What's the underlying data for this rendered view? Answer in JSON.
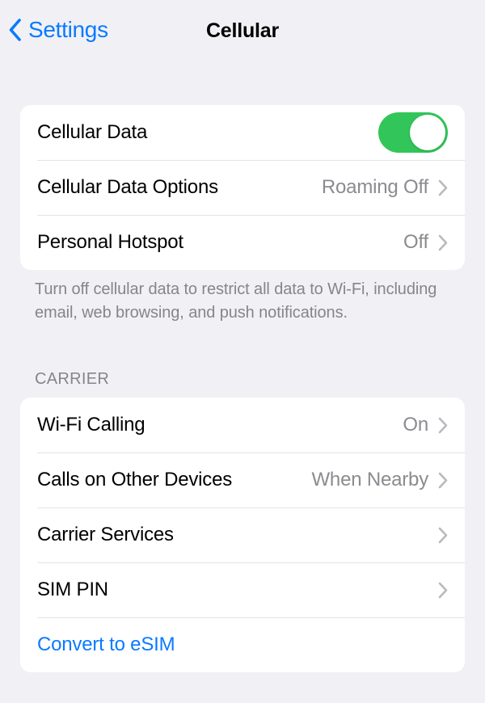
{
  "navbar": {
    "back_label": "Settings",
    "back_icon": "chevron-left-icon",
    "title": "Cellular"
  },
  "data_section": {
    "rows": [
      {
        "label": "Cellular Data",
        "control": "toggle",
        "toggle_on": true,
        "value": ""
      },
      {
        "label": "Cellular Data Options",
        "control": "disclosure",
        "value": "Roaming Off"
      },
      {
        "label": "Personal Hotspot",
        "control": "disclosure",
        "value": "Off"
      }
    ],
    "footer": "Turn off cellular data to restrict all data to Wi-Fi, including email, web browsing, and push notifications."
  },
  "carrier_section": {
    "header": "CARRIER",
    "rows": [
      {
        "label": "Wi-Fi Calling",
        "control": "disclosure",
        "value": "On"
      },
      {
        "label": "Calls on Other Devices",
        "control": "disclosure",
        "value": "When Nearby"
      },
      {
        "label": "Carrier Services",
        "control": "disclosure",
        "value": ""
      },
      {
        "label": "SIM PIN",
        "control": "disclosure",
        "value": ""
      },
      {
        "label": "Convert to eSIM",
        "control": "link",
        "value": ""
      }
    ]
  },
  "colors": {
    "accent_blue": "#0a7aff",
    "toggle_green": "#32c65a",
    "background": "#f1f1f5",
    "card": "#ffffff",
    "secondary_text": "#8b8b90",
    "chevron": "#b9b9be"
  }
}
